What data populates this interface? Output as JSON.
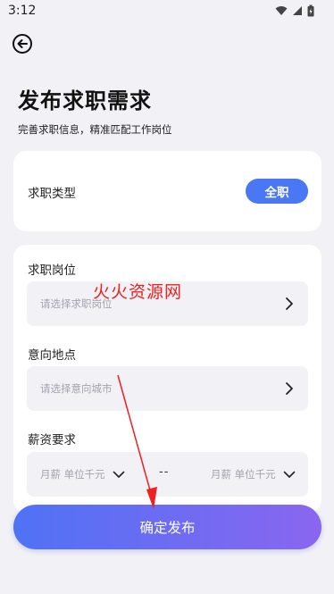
{
  "status_bar": {
    "time": "3:12"
  },
  "header": {
    "title": "发布求职需求",
    "subtitle": "完善求职信息，精准匹配工作岗位"
  },
  "job_type": {
    "label": "求职类型",
    "value": "全职"
  },
  "position": {
    "label": "求职岗位",
    "placeholder": "请选择求职岗位"
  },
  "location": {
    "label": "意向地点",
    "placeholder": "请选择意向城市"
  },
  "salary": {
    "label": "薪资要求",
    "min_placeholder": "月薪 单位千元",
    "separator": "--",
    "max_placeholder": "月薪 单位千元"
  },
  "watermark": "火火资源网",
  "submit_label": "确定发布",
  "colors": {
    "accent": "#4a78f4",
    "gradient_end": "#8a66f0",
    "annotation": "#ee2020"
  }
}
